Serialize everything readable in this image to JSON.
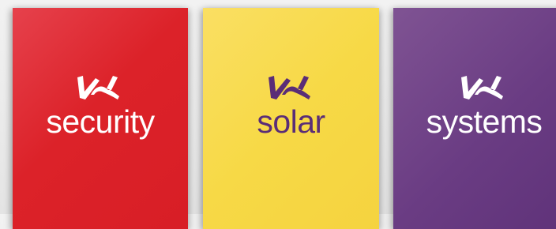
{
  "cards": [
    {
      "label": "security",
      "logo_icon": "ua-logo-icon",
      "background": "#dc2229",
      "text_color": "#ffffff"
    },
    {
      "label": "solar",
      "logo_icon": "ua-logo-icon",
      "background": "#f7d946",
      "text_color": "#5a2d77"
    },
    {
      "label": "systems",
      "logo_icon": "ua-logo-icon",
      "background": "#6a3c83",
      "text_color": "#ffffff"
    }
  ]
}
